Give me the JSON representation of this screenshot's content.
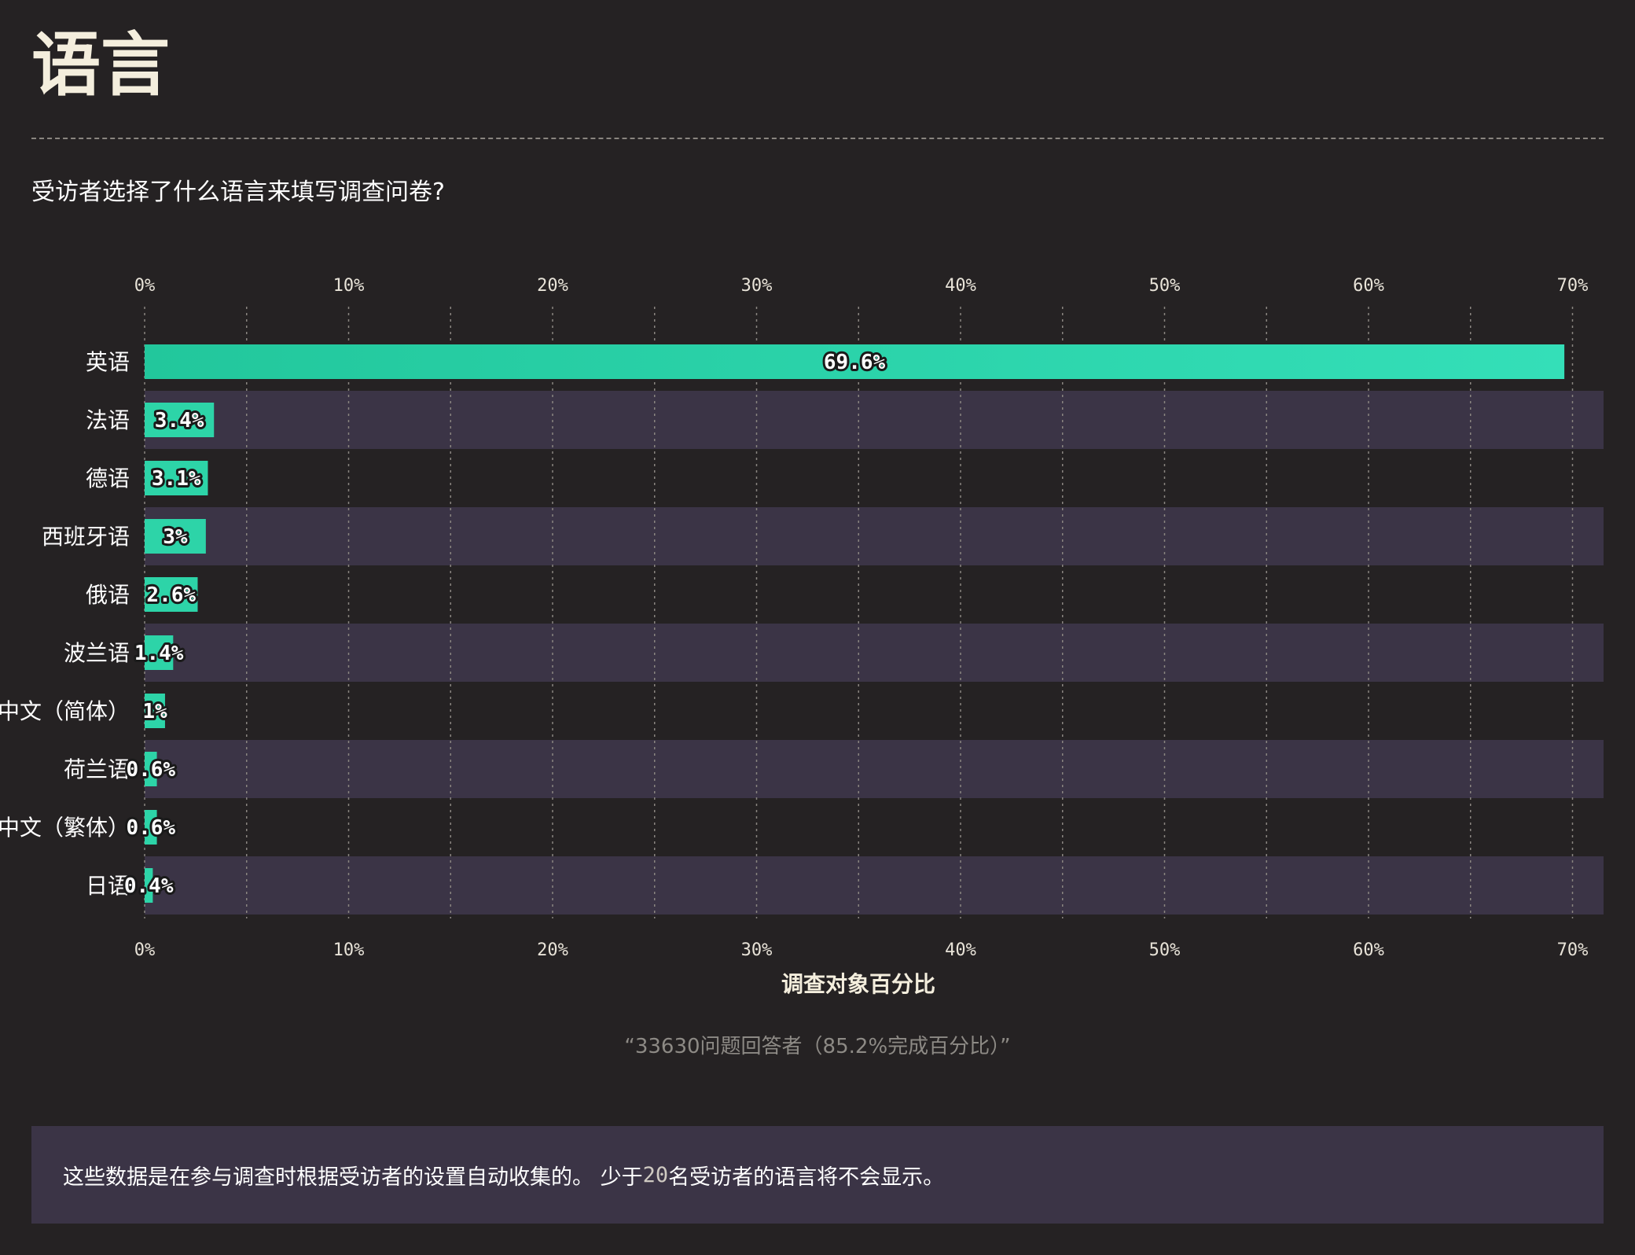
{
  "page": {
    "title": "语言",
    "question": "受访者选择了什么语言来填写调查问卷?"
  },
  "chart_data": {
    "type": "bar",
    "orientation": "horizontal",
    "categories": [
      "英语",
      "法语",
      "德语",
      "西班牙语",
      "俄语",
      "波兰语",
      "中文（简体）",
      "荷兰语",
      "中文（繁体）",
      "日语"
    ],
    "values": [
      69.6,
      3.4,
      3.1,
      3,
      2.6,
      1.4,
      1,
      0.6,
      0.6,
      0.4
    ],
    "value_labels": [
      "69.6%",
      "3.4%",
      "3.1%",
      "3%",
      "2.6%",
      "1.4%",
      "1%",
      "0.6%",
      "0.6%",
      "0.4%"
    ],
    "xlabel": "调查对象百分比",
    "ticks": [
      "0%",
      "10%",
      "20%",
      "30%",
      "40%",
      "50%",
      "60%",
      "70%"
    ],
    "xlim": [
      0,
      70
    ],
    "axis_position": "top-and-bottom",
    "grid": true,
    "colors": {
      "bar": "#2dd4a8",
      "bar_light": "#34dfb8",
      "band": "#3b3446",
      "background": "#252223"
    }
  },
  "summary": {
    "text": "“33630问题回答者（85.2%完成百分比）”"
  },
  "footnote": {
    "text_before": "这些数据是在参与调查时根据受访者的设置自动收集的。 少于 ",
    "number": "20",
    "text_after": " 名受访者的语言将不会显示。"
  }
}
